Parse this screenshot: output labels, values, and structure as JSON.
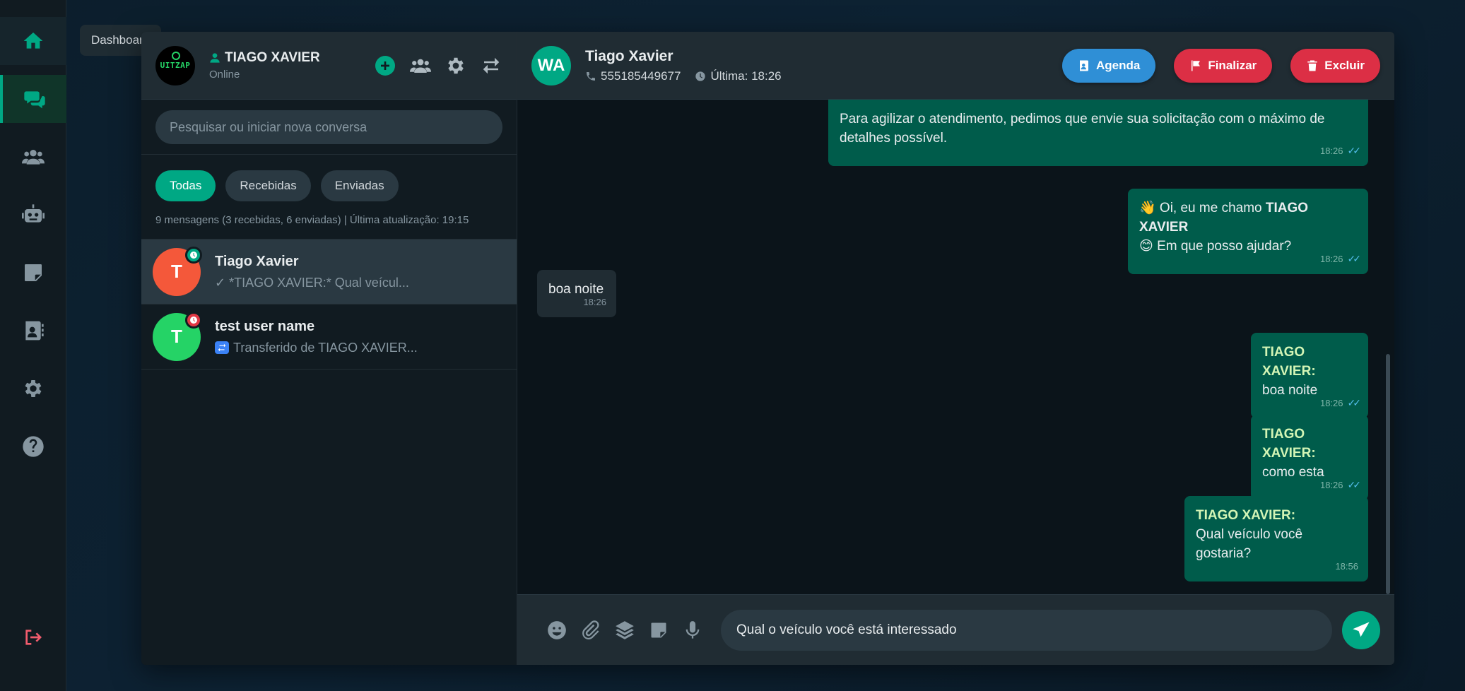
{
  "tooltip": "Dashboard",
  "user": {
    "name": "TIAGO XAVIER",
    "status": "Online",
    "logo_text": "UITZAP"
  },
  "search": {
    "placeholder": "Pesquisar ou iniciar nova conversa"
  },
  "filters": [
    "Todas",
    "Recebidas",
    "Enviadas"
  ],
  "summary": "9 mensagens (3 recebidas, 6 enviadas) | Última atualização: 19:15",
  "conversations": [
    {
      "initial": "T",
      "name": "Tiago Xavier",
      "preview": "✓ *TIAGO XAVIER:* Qual veícul...",
      "avatar_color": "#f4583a",
      "badge_color": "#00a884"
    },
    {
      "initial": "T",
      "name": "test user name",
      "preview": "Transferido de TIAGO XAVIER...",
      "avatar_color": "#25d366",
      "badge_color": "#e23744"
    }
  ],
  "chat": {
    "avatar": "WA",
    "name": "Tiago Xavier",
    "phone": "555185449677",
    "last_seen": "Última: 18:26",
    "buttons": {
      "agenda": "Agenda",
      "finalizar": "Finalizar",
      "excluir": "Excluir"
    }
  },
  "messages": [
    {
      "text": "Para agilizar o atendimento, pedimos que envie sua solicitação com o máximo de detalhes possível.",
      "time": "18:26"
    },
    {
      "line1_prefix": "👋 Oi, eu me chamo ",
      "line1_bold": "TIAGO XAVIER",
      "line2": "😊 Em que posso ajudar?",
      "time": "18:26"
    },
    {
      "text": "boa noite",
      "time": "18:26"
    },
    {
      "sender": "TIAGO XAVIER:",
      "text": "boa noite",
      "time": "18:26"
    },
    {
      "sender": "TIAGO XAVIER:",
      "text": "como esta",
      "time": "18:26"
    },
    {
      "sender": "TIAGO XAVIER:",
      "text": "Qual veículo você gostaria?",
      "time": "18:56"
    }
  ],
  "composer": {
    "value": "Qual o veículo você está interessado"
  },
  "icons": [
    "home-icon",
    "chat-icon",
    "users-icon",
    "robot-icon",
    "note-icon",
    "contacts-icon",
    "gear-icon",
    "help-icon",
    "logout-icon"
  ],
  "colors": {
    "accent": "#00a884",
    "outgoing": "#005c4b",
    "danger": "#dc2f45",
    "info": "#2f8fd6"
  }
}
